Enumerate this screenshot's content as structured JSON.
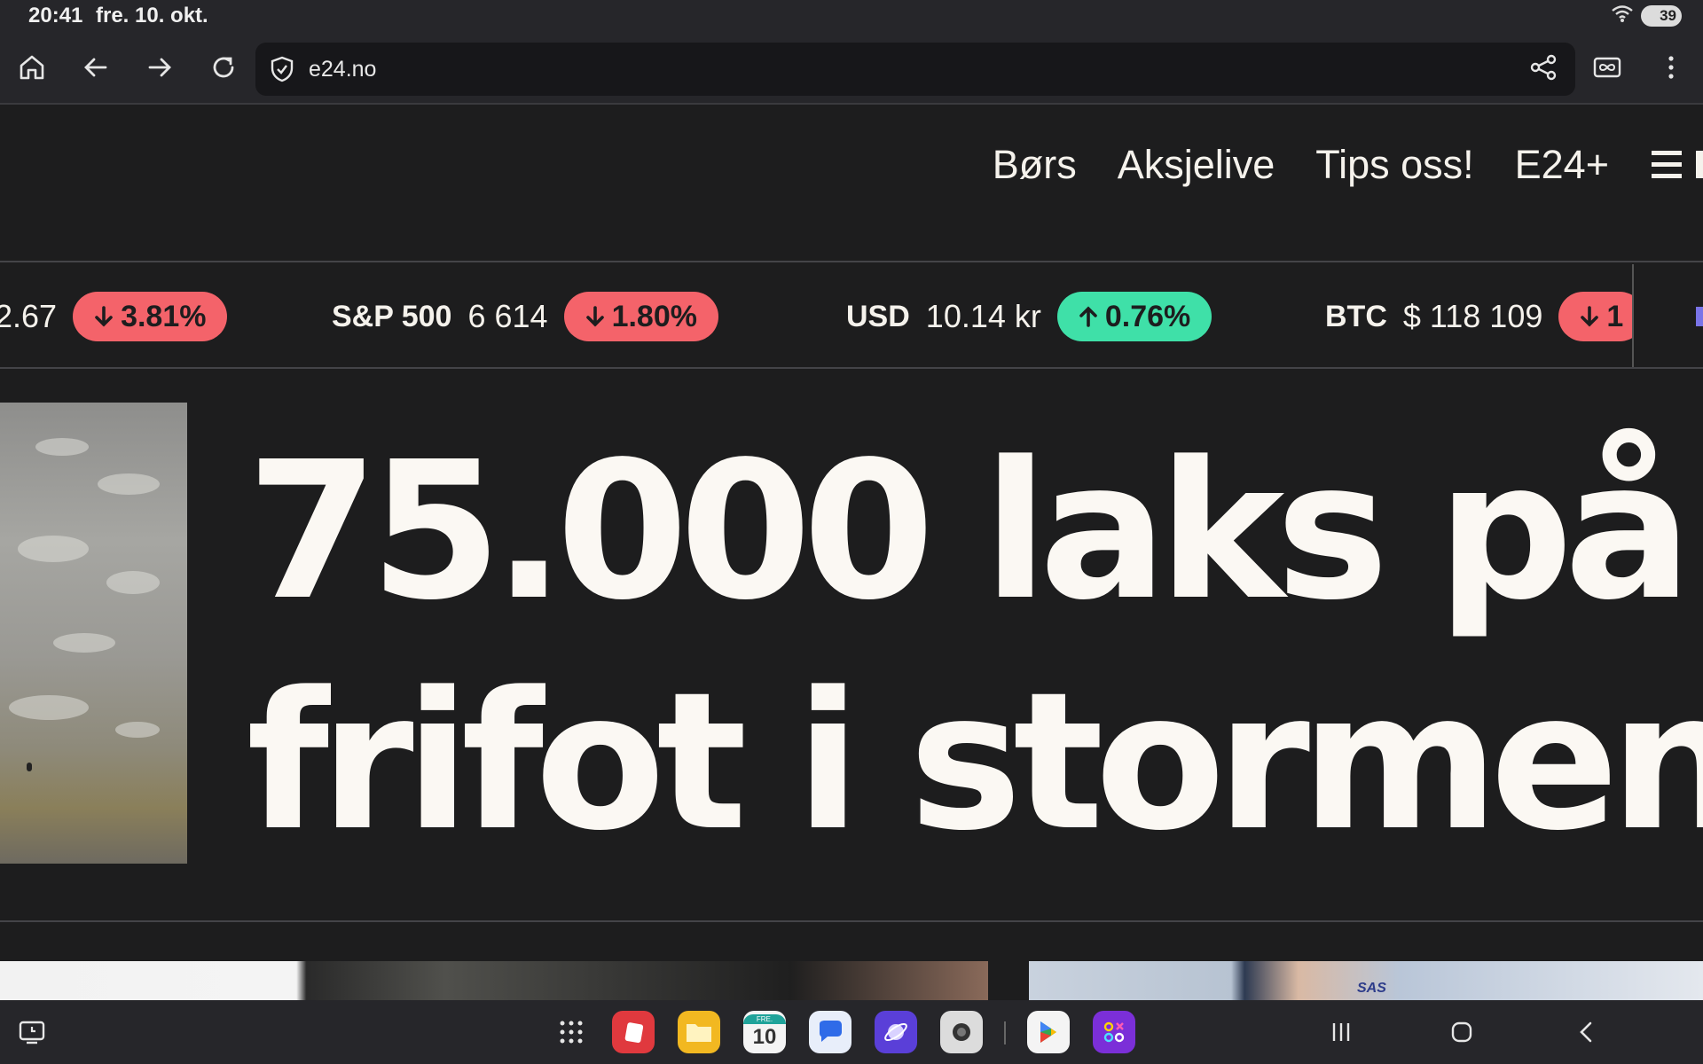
{
  "status": {
    "time": "20:41",
    "date": "fre. 10. okt.",
    "battery": "39"
  },
  "browser": {
    "url": "e24.no"
  },
  "nav": {
    "items": [
      "Børs",
      "Aksjelive",
      "Tips oss!",
      "E24+"
    ]
  },
  "ticker": {
    "items": [
      {
        "symbol": "",
        "value": "2.67",
        "change": "3.81%",
        "direction": "down"
      },
      {
        "symbol": "S&P 500",
        "value": "6 614",
        "change": "1.80%",
        "direction": "down"
      },
      {
        "symbol": "USD",
        "value": "10.14 kr",
        "change": "0.76%",
        "direction": "up"
      },
      {
        "symbol": "BTC",
        "value": "$ 118 109",
        "change": "1",
        "direction": "down"
      }
    ]
  },
  "hero": {
    "title_line1": "75.000 laks på",
    "title_line2": "frifot i stormen"
  },
  "thumbnails": {
    "sas_logo_text": "SAS"
  },
  "taskbar": {
    "calendar_day": "10",
    "calendar_weekday": "FRE."
  },
  "colors": {
    "down": "#f4636a",
    "up": "#3fe0a8",
    "background": "#1d1d1e"
  }
}
